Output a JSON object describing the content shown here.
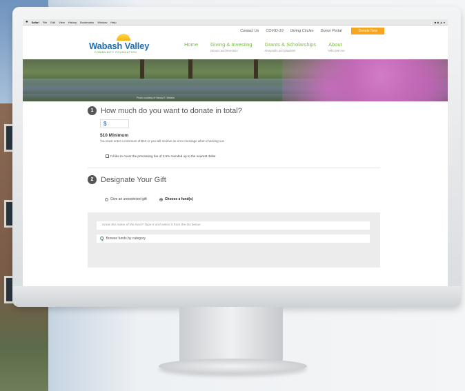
{
  "os_menu": {
    "apple_icon": "apple-icon",
    "items": [
      "Safari",
      "File",
      "Edit",
      "View",
      "History",
      "Bookmarks",
      "Window",
      "Help"
    ]
  },
  "top_links": {
    "contact": "Contact Us",
    "covid": "COVID-19",
    "giving_circles": "Giving Circles",
    "donor_portal": "Donor Portal",
    "donate_button": "Donate Now"
  },
  "logo": {
    "name": "Wabash Valley",
    "subtitle": "COMMUNITY FOUNDATION"
  },
  "nav": [
    {
      "label": "Home",
      "sub": ""
    },
    {
      "label": "Giving & Investing",
      "sub": "Donors and Investors"
    },
    {
      "label": "Grants & Scholarships",
      "sub": "Nonprofits and Students"
    },
    {
      "label": "About",
      "sub": "Who We Are"
    }
  ],
  "hero": {
    "caption": "Photo courtesy of Nancy E. Wetzler"
  },
  "step1": {
    "number": "1",
    "title": "How much do you want to donate in total?",
    "currency": "$",
    "minimum_label": "$10 Minimum",
    "minimum_help": "You must enter a minimum of $10 or you will receive an error message when checking out.",
    "fee_option": "I'd like to cover the processing fee of 2.9% rounded up to the nearest dollar"
  },
  "step2": {
    "number": "2",
    "title": "Designate Your Gift",
    "option_unrestricted": "Give an unrestricted gift",
    "option_fund": "Choose a fund(s)",
    "search_placeholder": "Know the name of the fund? Type it and select it from the list below",
    "browse_label": "Browse funds by category"
  },
  "colors": {
    "brand_blue": "#1f6fb2",
    "nav_green": "#7cb84a",
    "donate_orange": "#f7a520"
  }
}
